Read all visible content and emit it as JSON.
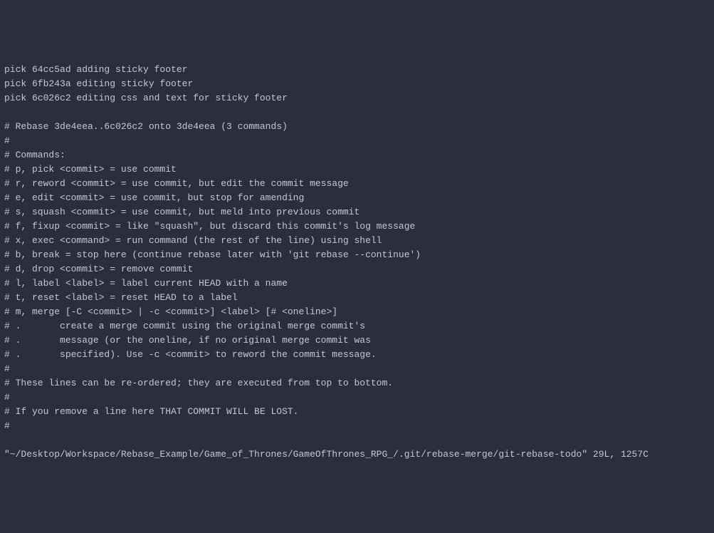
{
  "editor": {
    "lines": [
      "pick 64cc5ad adding sticky footer",
      "pick 6fb243a editing sticky footer",
      "pick 6c026c2 editing css and text for sticky footer",
      "",
      "# Rebase 3de4eea..6c026c2 onto 3de4eea (3 commands)",
      "#",
      "# Commands:",
      "# p, pick <commit> = use commit",
      "# r, reword <commit> = use commit, but edit the commit message",
      "# e, edit <commit> = use commit, but stop for amending",
      "# s, squash <commit> = use commit, but meld into previous commit",
      "# f, fixup <commit> = like \"squash\", but discard this commit's log message",
      "# x, exec <command> = run command (the rest of the line) using shell",
      "# b, break = stop here (continue rebase later with 'git rebase --continue')",
      "# d, drop <commit> = remove commit",
      "# l, label <label> = label current HEAD with a name",
      "# t, reset <label> = reset HEAD to a label",
      "# m, merge [-C <commit> | -c <commit>] <label> [# <oneline>]",
      "# .       create a merge commit using the original merge commit's",
      "# .       message (or the oneline, if no original merge commit was",
      "# .       specified). Use -c <commit> to reword the commit message.",
      "#",
      "# These lines can be re-ordered; they are executed from top to bottom.",
      "#",
      "# If you remove a line here THAT COMMIT WILL BE LOST.",
      "#"
    ],
    "status_line": "\"~/Desktop/Workspace/Rebase_Example/Game_of_Thrones/GameOfThrones_RPG_/.git/rebase-merge/git-rebase-todo\" 29L, 1257C"
  }
}
